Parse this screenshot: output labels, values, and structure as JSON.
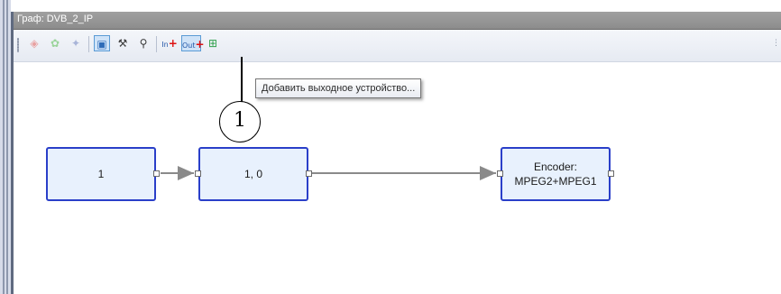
{
  "window": {
    "title": "Граф: DVB_2_IP"
  },
  "toolbar": {
    "buttons": [
      {
        "name": "add-node-button",
        "icon": "diamond-icon",
        "glyph": "◈"
      },
      {
        "name": "connect-button",
        "icon": "gear-plus-icon",
        "glyph": "✿"
      },
      {
        "name": "properties-button",
        "icon": "settings-icon",
        "glyph": "✦"
      },
      {
        "name": "select-button",
        "icon": "select-icon",
        "glyph": "▣"
      },
      {
        "name": "remove-link-button",
        "icon": "wrench-icon",
        "glyph": "⚒"
      },
      {
        "name": "tool-button",
        "icon": "pin-icon",
        "glyph": "⚲"
      },
      {
        "name": "add-input-button",
        "icon": "add-input-icon",
        "glyph": "In"
      },
      {
        "name": "add-output-button",
        "icon": "add-output-icon",
        "glyph": "Out"
      },
      {
        "name": "layout-button",
        "icon": "graph-layout-icon",
        "glyph": "⊞"
      }
    ]
  },
  "tooltip": {
    "text": "Добавить выходное устройство..."
  },
  "callout": {
    "label": "1"
  },
  "graph": {
    "nodes": [
      {
        "id": "n1",
        "label": "1"
      },
      {
        "id": "n2",
        "label": "1, 0"
      },
      {
        "id": "n3",
        "label_line1": "Encoder:",
        "label_line2": "MPEG2+MPEG1"
      }
    ]
  },
  "colors": {
    "node_border": "#2a3fc9",
    "node_fill": "#e8f1fd",
    "link": "#8a8a8a",
    "titlebar": "#969696"
  }
}
